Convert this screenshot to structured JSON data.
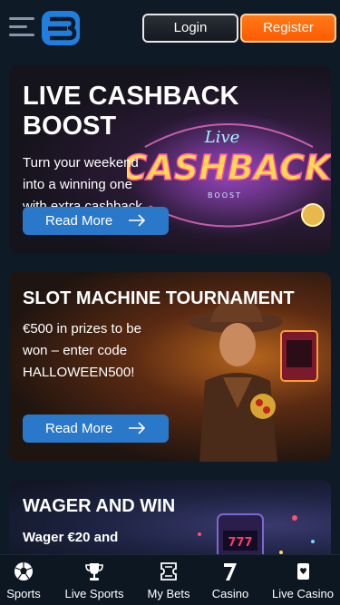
{
  "header": {
    "login_label": "Login",
    "register_label": "Register",
    "accent_color": "#1f7ee0",
    "register_color": "#ff6a0a"
  },
  "promos": [
    {
      "title": "LIVE CASHBACK BOOST",
      "description": "Turn your weekend into a winning one with extra cashback o...",
      "button_label": "Read More",
      "art_text": "CASHBACK",
      "art_small_1": "Live",
      "art_small_2": "BOOST"
    },
    {
      "title": "SLOT MACHINE TOURNAMENT",
      "description": "€500 in prizes to be won – enter code HALLOWEEN500!",
      "button_label": "Read More"
    },
    {
      "title": "WAGER AND WIN",
      "description": "Wager €20 and"
    }
  ],
  "bottom_nav": [
    {
      "label": "Sports",
      "icon": "soccer-ball-icon"
    },
    {
      "label": "Live Sports",
      "icon": "trophy-icon"
    },
    {
      "label": "My Bets",
      "icon": "ticket-icon"
    },
    {
      "label": "Casino",
      "icon": "seven-icon"
    },
    {
      "label": "Live Casino",
      "icon": "cards-icon"
    }
  ]
}
